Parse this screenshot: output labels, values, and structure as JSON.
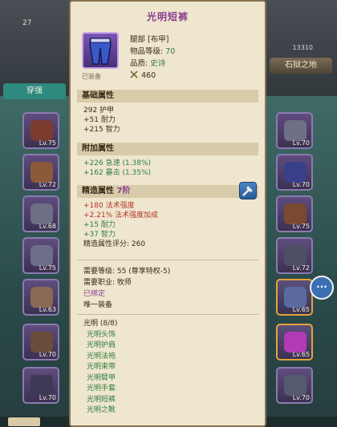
{
  "background": {
    "top_left_title": "",
    "top_count": "27",
    "top_right_number": "13310",
    "place_button": "石狱之地",
    "strengthen_tab": "穿强",
    "left_slots": [
      {
        "level": "Lv.75",
        "color": "#7b3b2e"
      },
      {
        "level": "Lv.72",
        "color": "#8c5a3a"
      },
      {
        "level": "Lv.68",
        "color": "#6e6e84"
      },
      {
        "level": "Lv.75",
        "color": "#6d6f88"
      },
      {
        "level": "Lv.63",
        "color": "#8a6a55"
      },
      {
        "level": "Lv.70",
        "color": "#6a4d3a"
      },
      {
        "level": "Lv.70",
        "color": "#3d3a55"
      }
    ],
    "right_slots": [
      {
        "level": "Lv.70",
        "color": "#6f6f88"
      },
      {
        "level": "Lv.70",
        "color": "#3a3f8a"
      },
      {
        "level": "Lv.75",
        "color": "#7a4a30"
      },
      {
        "level": "Lv.72",
        "color": "#4e4e66"
      },
      {
        "level": "Lv.65",
        "color": "#5a6aa0"
      },
      {
        "level": "Lv.65",
        "color": "#b13ab5"
      },
      {
        "level": "Lv.70",
        "color": "#555a70"
      }
    ],
    "chat_icon": "chat-bubble-icon"
  },
  "tooltip": {
    "title": "光明短裤",
    "equipped_label": "已装备",
    "slot_type": "腿部 [布甲]",
    "item_level_label": "物品等级:",
    "item_level": "70",
    "quality_label": "品质:",
    "quality": "史诗",
    "power": "460",
    "base_header": "基础属性",
    "base_stats": [
      "292 护甲",
      "+51 耐力",
      "+215 智力"
    ],
    "extra_header": "附加属性",
    "extra_stats": [
      "+226 急速 (1.38%)",
      "+162 暴击 (1.35%)"
    ],
    "refine_header": "精造属性",
    "refine_tier": "7阶",
    "refine_stats": [
      {
        "text": "+180 法术强度",
        "color": "red"
      },
      {
        "text": "+2.21% 法术强度加成",
        "color": "red"
      },
      {
        "text": "+15 耐力",
        "color": "green"
      },
      {
        "text": "+37 智力",
        "color": "green"
      }
    ],
    "refine_score": "精造属性评分: 260",
    "req_level": "需要等级: 55 (尊享特权-5)",
    "req_class": "需要职业: 牧师",
    "bound": "已绑定",
    "unique": "唯一装备",
    "set_name": "光明 (8/8)",
    "set_items": [
      "光明头饰",
      "光明护肩",
      "光明法袍",
      "光明束带",
      "光明臂甲",
      "光明手套",
      "光明短裤",
      "光明之靴"
    ]
  }
}
